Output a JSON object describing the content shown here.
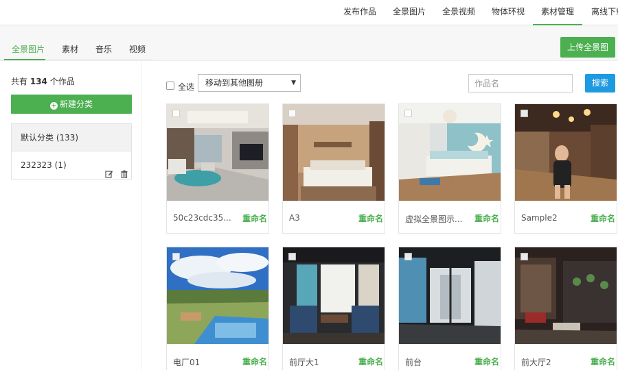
{
  "topnav": {
    "items": [
      "发布作品",
      "全景图片",
      "全景视频",
      "物体环视",
      "素材管理",
      "离线下载"
    ],
    "active_index": 4
  },
  "tabs": {
    "items": [
      "全景图片",
      "素材",
      "音乐",
      "视频"
    ],
    "active_index": 0
  },
  "upload_label": "上传全景图",
  "left": {
    "count_prefix": "共有",
    "count_value": "134",
    "count_suffix": "个作品",
    "new_category_label": "新建分类",
    "categories": [
      {
        "label": "默认分类 (133)"
      },
      {
        "label": "232323 (1)"
      }
    ]
  },
  "toolbar": {
    "select_all_label": "全选",
    "move_select_value": "移动到其他图册",
    "search_placeholder": "作品名",
    "search_label": "搜索"
  },
  "cards": [
    {
      "name": "50c23cdc35...",
      "rename": "重命名"
    },
    {
      "name": "A3",
      "rename": "重命名"
    },
    {
      "name": "虚拟全景图示...",
      "rename": "重命名"
    },
    {
      "name": "Sample2",
      "rename": "重命名"
    },
    {
      "name": "电厂01",
      "rename": "重命名"
    },
    {
      "name": "前厅大1",
      "rename": "重命名"
    },
    {
      "name": "前台",
      "rename": "重命名"
    },
    {
      "name": "前大厅2",
      "rename": "重命名"
    }
  ],
  "colors": {
    "accent": "#4caf50",
    "search_button": "#1e9ae0"
  },
  "icons": [
    "plus-circle-icon",
    "edit-icon",
    "trash-icon",
    "caret-down-icon"
  ]
}
